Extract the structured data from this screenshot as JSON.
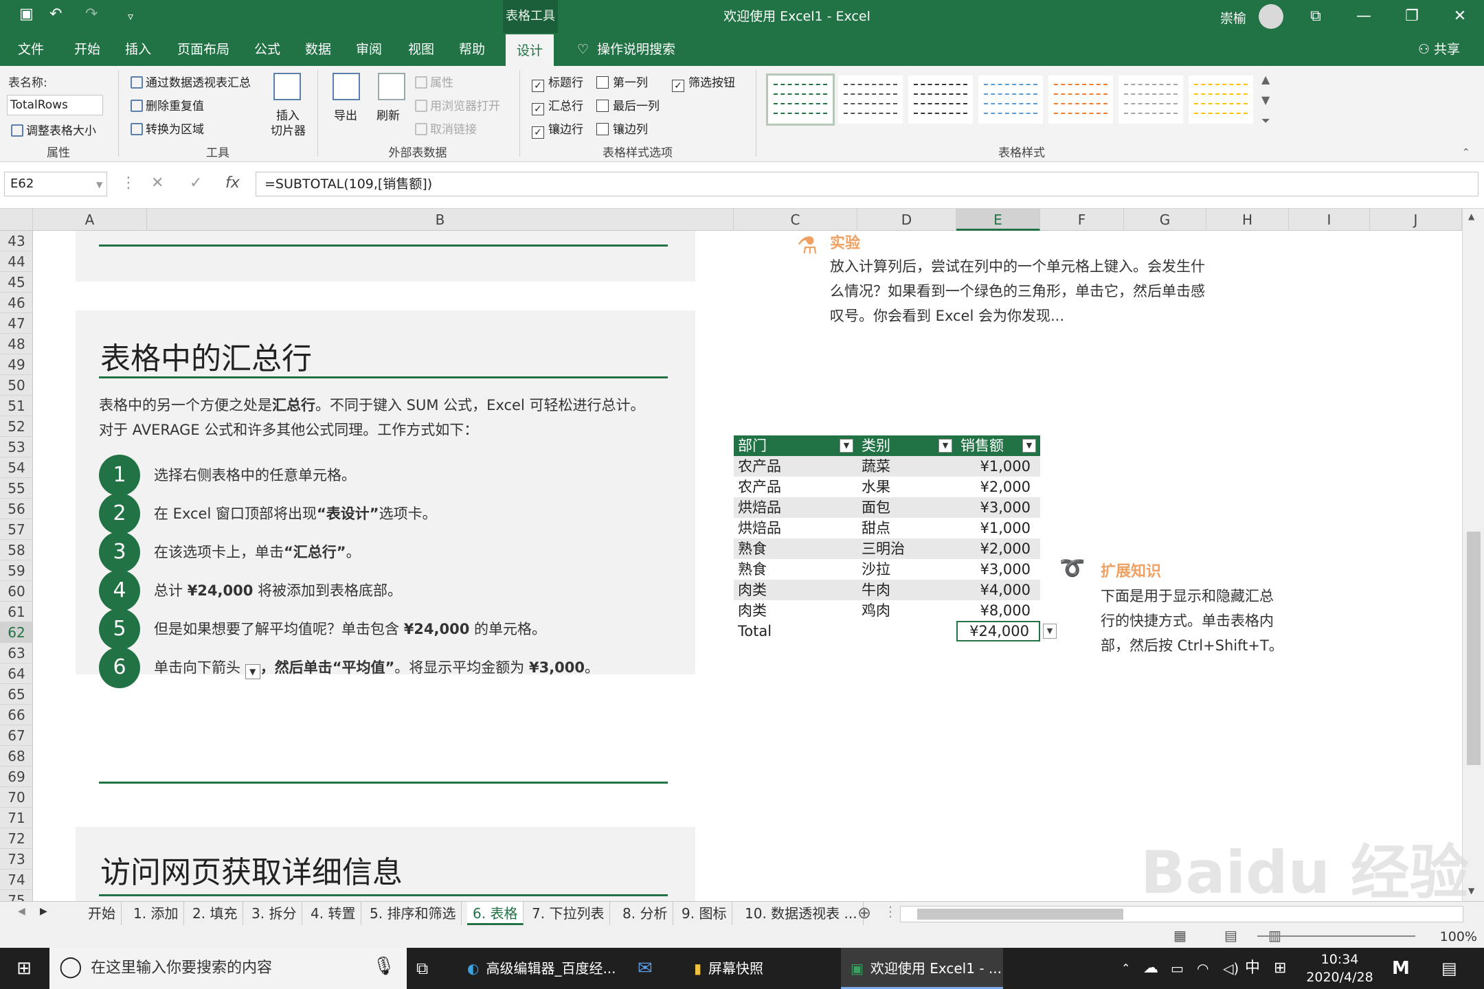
{
  "window": {
    "title": "欢迎使用 Excel1  -  Excel",
    "context_tab": "表格工具",
    "user": "崇榆",
    "quick_access_more": "▿"
  },
  "ribbon_tabs": [
    "文件",
    "开始",
    "插入",
    "页面布局",
    "公式",
    "数据",
    "审阅",
    "视图",
    "帮助",
    "设计"
  ],
  "active_tab": "设计",
  "tell_me": "操作说明搜索",
  "share": "共享",
  "ribbon": {
    "properties": {
      "table_name_label": "表名称:",
      "table_name_value": "TotalRows",
      "resize": "调整表格大小",
      "group": "属性"
    },
    "tools": {
      "pivot": "通过数据透视表汇总",
      "dedupe": "删除重复值",
      "to_range": "转换为区域",
      "slicer_line1": "插入",
      "slicer_line2": "切片器",
      "group": "工具"
    },
    "external": {
      "export": "导出",
      "refresh": "刷新",
      "properties": "属性",
      "open_browser": "用浏览器打开",
      "unlink": "取消链接",
      "group": "外部表数据"
    },
    "style_options": {
      "header_row": "标题行",
      "total_row": "汇总行",
      "banded_rows": "镶边行",
      "first_col": "第一列",
      "last_col": "最后一列",
      "banded_cols": "镶边列",
      "filter_btn": "筛选按钮",
      "group": "表格样式选项"
    },
    "styles": {
      "group": "表格样式",
      "colors": [
        "#217346",
        "#555555",
        "#333333",
        "#5b9bd5",
        "#ed7d31",
        "#a5a5a5",
        "#ffc000"
      ]
    }
  },
  "formula_bar": {
    "name_box": "E62",
    "formula": "=SUBTOTAL(109,[销售额])",
    "fx": "fx"
  },
  "columns": [
    "A",
    "B",
    "C",
    "D",
    "E",
    "F",
    "G",
    "H",
    "I",
    "J"
  ],
  "selected_column": "E",
  "rows": [
    "43",
    "44",
    "45",
    "46",
    "47",
    "48",
    "49",
    "50",
    "51",
    "52",
    "53",
    "54",
    "55",
    "56",
    "57",
    "58",
    "59",
    "60",
    "61",
    "62",
    "63",
    "64",
    "65",
    "66",
    "67",
    "68",
    "69",
    "70",
    "71",
    "72",
    "73",
    "74",
    "75"
  ],
  "selected_row": "62",
  "content": {
    "section_title": "表格中的汇总行",
    "intro_line1_a": "表格中的另一个方便之处是",
    "intro_line1_b": "汇总行",
    "intro_line1_c": "。不同于键入 SUM 公式，Excel 可轻松进行总计。",
    "intro_line2": "对于 AVERAGE 公式和许多其他公式同理。工作方式如下：",
    "steps": [
      {
        "num": "1",
        "pre": "选择右侧表格中的任意单元格。",
        "bold": "",
        "post": ""
      },
      {
        "num": "2",
        "pre": "在 Excel 窗口顶部将出现",
        "bold": "“表设计”",
        "post": "选项卡。"
      },
      {
        "num": "3",
        "pre": "在该选项卡上，单击",
        "bold": "“汇总行”",
        "post": "。"
      },
      {
        "num": "4",
        "pre": "总计 ",
        "bold": "¥24,000",
        "post": " 将被添加到表格底部。"
      },
      {
        "num": "5",
        "pre": "但是如果想要了解平均值呢？单击包含 ",
        "bold": "¥24,000",
        "post": " 的单元格。"
      },
      {
        "num": "6",
        "pre": "单击向下箭头 ",
        "bold": "",
        "post": "，然后单击",
        "bold2": "“平均值”",
        "post2": "。将显示平均金额为 ",
        "bold3": "¥3,000",
        "post3": "。"
      }
    ],
    "next_title": "访问网页获取详细信息",
    "experiment": {
      "head": "实验",
      "lines": [
        "放入计算列后，尝试在列中的一个单元格上键入。会发生什",
        "么情况？如果看到一个绿色的三角形，单击它，然后单击感",
        "叹号。你会看到 Excel 会为你发现..."
      ]
    },
    "extend": {
      "head": "扩展知识",
      "lines": [
        "下面是用于显示和隐藏汇总",
        "行的快捷方式。单击表格内",
        "部，然后按 Ctrl+Shift+T。"
      ]
    }
  },
  "table": {
    "headers": [
      "部门",
      "类别",
      "销售额"
    ],
    "rows": [
      [
        "农产品",
        "蔬菜",
        "¥1,000"
      ],
      [
        "农产品",
        "水果",
        "¥2,000"
      ],
      [
        "烘焙品",
        "面包",
        "¥3,000"
      ],
      [
        "烘焙品",
        "甜点",
        "¥1,000"
      ],
      [
        "熟食",
        "三明治",
        "¥2,000"
      ],
      [
        "熟食",
        "沙拉",
        "¥3,000"
      ],
      [
        "肉类",
        "牛肉",
        "¥4,000"
      ],
      [
        "肉类",
        "鸡肉",
        "¥8,000"
      ]
    ],
    "total_label": "Total",
    "total_value": "¥24,000"
  },
  "sheet_tabs": [
    "开始",
    "1. 添加",
    "2. 填充",
    "3. 拆分",
    "4. 转置",
    "5. 排序和筛选",
    "6. 表格",
    "7. 下拉列表",
    "8. 分析",
    "9. 图标",
    "10. 数据透视表 ..."
  ],
  "active_sheet": "6. 表格",
  "status": {
    "zoom": "100%"
  },
  "taskbar": {
    "search_placeholder": "在这里输入你要搜索的内容",
    "apps": [
      "高级编辑器_百度经...",
      "屏幕快照",
      "欢迎使用 Excel1 - ..."
    ],
    "ime": "中",
    "time": "10:34",
    "date": "2020/4/28"
  },
  "watermark": "Baidu 经验"
}
